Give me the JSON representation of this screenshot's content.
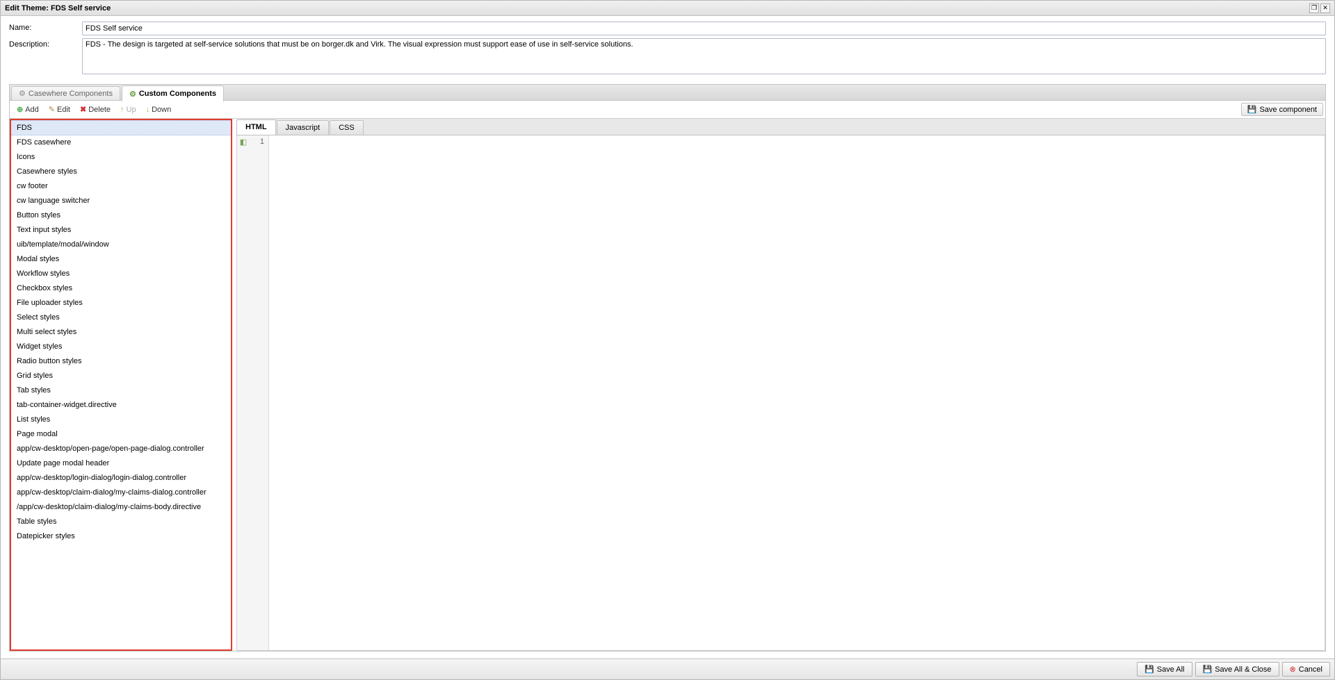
{
  "window": {
    "title": "Edit Theme: FDS Self service"
  },
  "form": {
    "name_label": "Name:",
    "name_value": "FDS Self service",
    "desc_label": "Description:",
    "desc_value": "FDS - The design is targeted at self-service solutions that must be on borger.dk and Virk. The visual expression must support ease of use in self-service solutions."
  },
  "outer_tabs": {
    "casewhere": "Casewhere Components",
    "custom": "Custom Components"
  },
  "toolbar": {
    "add": "Add",
    "edit": "Edit",
    "delete": "Delete",
    "up": "Up",
    "down": "Down",
    "save_component": "Save component"
  },
  "list": {
    "selected_index": 0,
    "items": [
      "FDS",
      "FDS casewhere",
      "Icons",
      "Casewhere styles",
      "cw footer",
      "cw language switcher",
      "Button styles",
      "Text input styles",
      "uib/template/modal/window",
      "Modal styles",
      "Workflow styles",
      "Checkbox styles",
      "File uploader styles",
      "Select styles",
      "Multi select styles",
      "Widget styles",
      "Radio button styles",
      "Grid styles",
      "Tab styles",
      "tab-container-widget.directive",
      "List styles",
      "Page modal",
      "app/cw-desktop/open-page/open-page-dialog.controller",
      "Update page modal header",
      "app/cw-desktop/login-dialog/login-dialog.controller",
      "app/cw-desktop/claim-dialog/my-claims-dialog.controller",
      "/app/cw-desktop/claim-dialog/my-claims-body.directive",
      "Table styles",
      "Datepicker styles"
    ]
  },
  "editor_tabs": {
    "html": "HTML",
    "js": "Javascript",
    "css": "CSS"
  },
  "editor": {
    "line_number": "1"
  },
  "footer": {
    "save_all": "Save All",
    "save_all_close": "Save All & Close",
    "cancel": "Cancel"
  }
}
